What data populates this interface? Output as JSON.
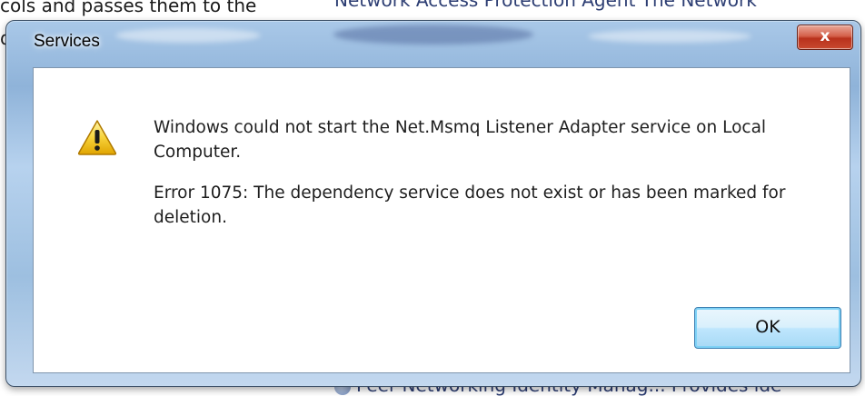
{
  "background": {
    "top_left_text": "cols and passes them to the",
    "top_right_text": "Network Access Protection Agent     The Network",
    "left_char": "d",
    "bottom_text": "Peer Networking Identity Manag...   Provides ide"
  },
  "dialog": {
    "title": "Services",
    "close_label": "x",
    "icon": "warning-icon",
    "message_line1": "Windows could not start the Net.Msmq Listener Adapter service on Local Computer.",
    "message_line2": "Error 1075: The dependency service does not exist or has been marked for deletion.",
    "ok_label": "OK"
  }
}
